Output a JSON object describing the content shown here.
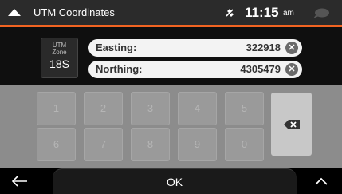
{
  "header": {
    "title": "UTM Coordinates",
    "time": "11:15",
    "ampm": "am"
  },
  "zone": {
    "label_line1": "UTM",
    "label_line2": "Zone",
    "value": "18S"
  },
  "fields": {
    "easting": {
      "label": "Easting:",
      "value": "322918"
    },
    "northing": {
      "label": "Northing:",
      "value": "4305479"
    }
  },
  "keypad": {
    "keys": [
      "1",
      "2",
      "3",
      "4",
      "5",
      "6",
      "7",
      "8",
      "9",
      "0"
    ]
  },
  "footer": {
    "ok_label": "OK"
  },
  "icons": {
    "up": "up-arrow-icon",
    "gps": "gps-satellite-icon",
    "message": "message-bubble-icon",
    "clear": "clear-icon",
    "backspace": "backspace-icon",
    "back": "back-arrow-icon",
    "expand": "chevron-up-icon"
  },
  "colors": {
    "accent": "#f26422",
    "topbar": "#2b2b2b",
    "keypad": "#8c8c8c",
    "field": "#f3f3f3"
  }
}
